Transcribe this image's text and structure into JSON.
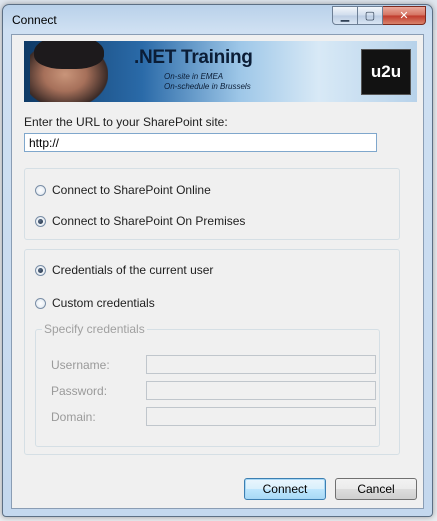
{
  "window": {
    "title": "Connect"
  },
  "caption": {
    "minimize": "▁",
    "maximize": "▢",
    "close": "✕"
  },
  "banner": {
    "title": ".NET Training",
    "line1": "On-site in EMEA",
    "line2": "On-schedule in Brussels",
    "logo": "u2u"
  },
  "url": {
    "label": "Enter the URL to your SharePoint site:",
    "value": "http://"
  },
  "connection": {
    "online_label": "Connect to SharePoint Online",
    "onprem_label": "Connect to SharePoint On Premises",
    "selected": "onprem"
  },
  "credentials": {
    "current_label": "Credentials of the current user",
    "custom_label": "Custom credentials",
    "selected": "current",
    "group_title": "Specify credentials",
    "username_label": "Username:",
    "password_label": "Password:",
    "domain_label": "Domain:"
  },
  "buttons": {
    "connect": "Connect",
    "cancel": "Cancel"
  }
}
